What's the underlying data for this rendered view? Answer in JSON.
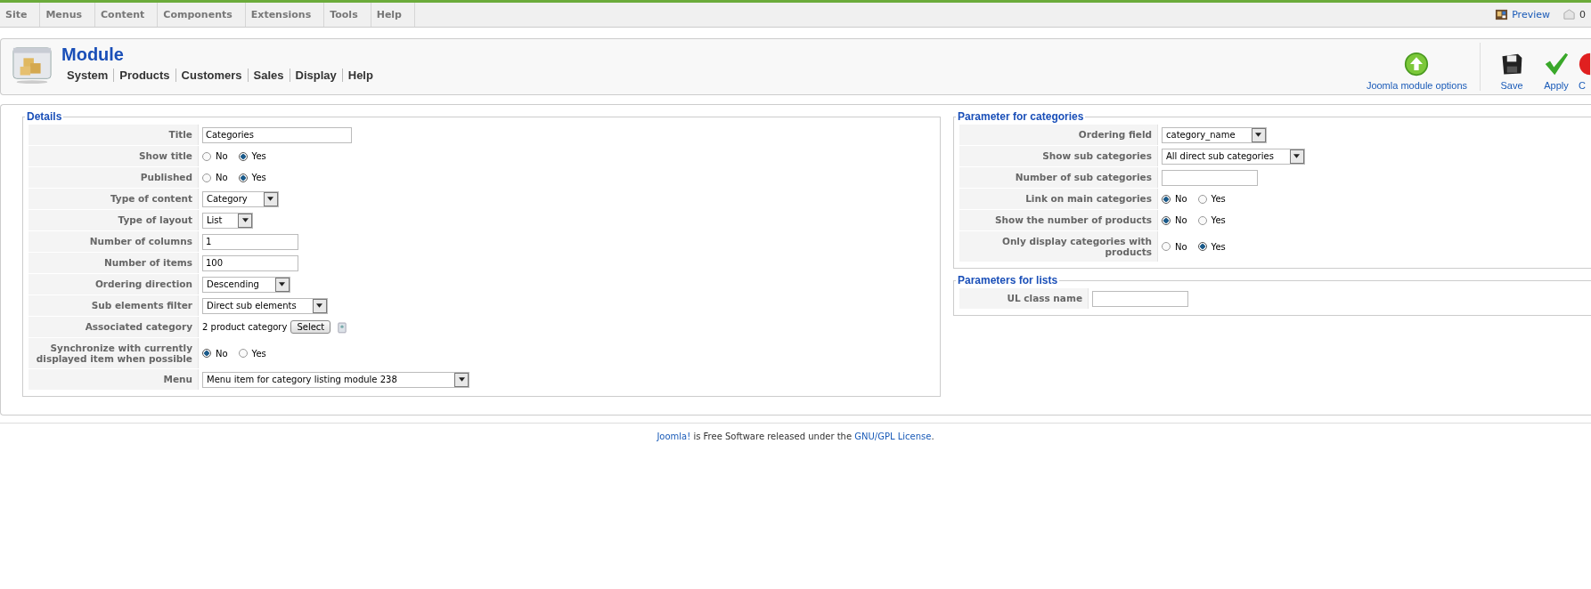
{
  "menu_bar": {
    "items": [
      "Site",
      "Menus",
      "Content",
      "Components",
      "Extensions",
      "Tools",
      "Help"
    ],
    "preview": "Preview",
    "messages": "0"
  },
  "header": {
    "title": "Module",
    "submenu": [
      "System",
      "Products",
      "Customers",
      "Sales",
      "Display",
      "Help"
    ],
    "toolbar": [
      {
        "kind": "options",
        "label": "Joomla module options"
      },
      {
        "kind": "save",
        "label": "Save"
      },
      {
        "kind": "apply",
        "label": "Apply"
      },
      {
        "kind": "cancel",
        "label": "C"
      }
    ]
  },
  "details": {
    "legend": "Details",
    "rows": [
      {
        "label": "Title",
        "kind": "text",
        "value": "Categories"
      },
      {
        "label": "Show title",
        "kind": "radio",
        "options": [
          {
            "label": "No",
            "selected": false
          },
          {
            "label": "Yes",
            "selected": true
          }
        ]
      },
      {
        "label": "Published",
        "kind": "radio",
        "options": [
          {
            "label": "No",
            "selected": false
          },
          {
            "label": "Yes",
            "selected": true
          }
        ]
      },
      {
        "label": "Type of content",
        "kind": "select",
        "value": "Category"
      },
      {
        "label": "Type of layout",
        "kind": "select",
        "value": "List"
      },
      {
        "label": "Number of columns",
        "kind": "short",
        "value": "1"
      },
      {
        "label": "Number of items",
        "kind": "short",
        "value": "100"
      },
      {
        "label": "Ordering direction",
        "kind": "select",
        "value": "Descending"
      },
      {
        "label": "Sub elements filter",
        "kind": "select",
        "value": "Direct sub elements"
      },
      {
        "label": "Associated category",
        "kind": "picker",
        "value": "2 product category",
        "button": "Select"
      },
      {
        "label": "Synchronize with currently displayed item when possible",
        "kind": "radio",
        "options": [
          {
            "label": "No",
            "selected": true
          },
          {
            "label": "Yes",
            "selected": false
          }
        ]
      },
      {
        "label": "Menu",
        "kind": "wide",
        "value": "Menu item for category listing module 238"
      }
    ]
  },
  "categories": {
    "legend": "Parameter for categories",
    "rows": [
      {
        "label": "Ordering field",
        "kind": "select",
        "value": "category_name"
      },
      {
        "label": "Show sub categories",
        "kind": "select",
        "value": "All direct sub categories"
      },
      {
        "label": "Number of sub categories",
        "kind": "short",
        "value": ""
      },
      {
        "label": "Link on main categories",
        "kind": "radio",
        "options": [
          {
            "label": "No",
            "selected": true
          },
          {
            "label": "Yes",
            "selected": false
          }
        ]
      },
      {
        "label": "Show the number of products",
        "kind": "radio",
        "options": [
          {
            "label": "No",
            "selected": true
          },
          {
            "label": "Yes",
            "selected": false
          }
        ]
      },
      {
        "label": "Only display categories with products",
        "kind": "radio",
        "options": [
          {
            "label": "No",
            "selected": false
          },
          {
            "label": "Yes",
            "selected": true
          }
        ]
      }
    ]
  },
  "lists": {
    "legend": "Parameters for lists",
    "rows": [
      {
        "label": "UL class name",
        "kind": "short",
        "value": ""
      }
    ]
  },
  "footer": [
    {
      "text": "Joomla!",
      "kind": "link"
    },
    {
      "text": " is Free Software released under the ",
      "kind": "text"
    },
    {
      "text": "GNU/GPL License",
      "kind": "link"
    },
    {
      "text": ".",
      "kind": "text"
    }
  ]
}
